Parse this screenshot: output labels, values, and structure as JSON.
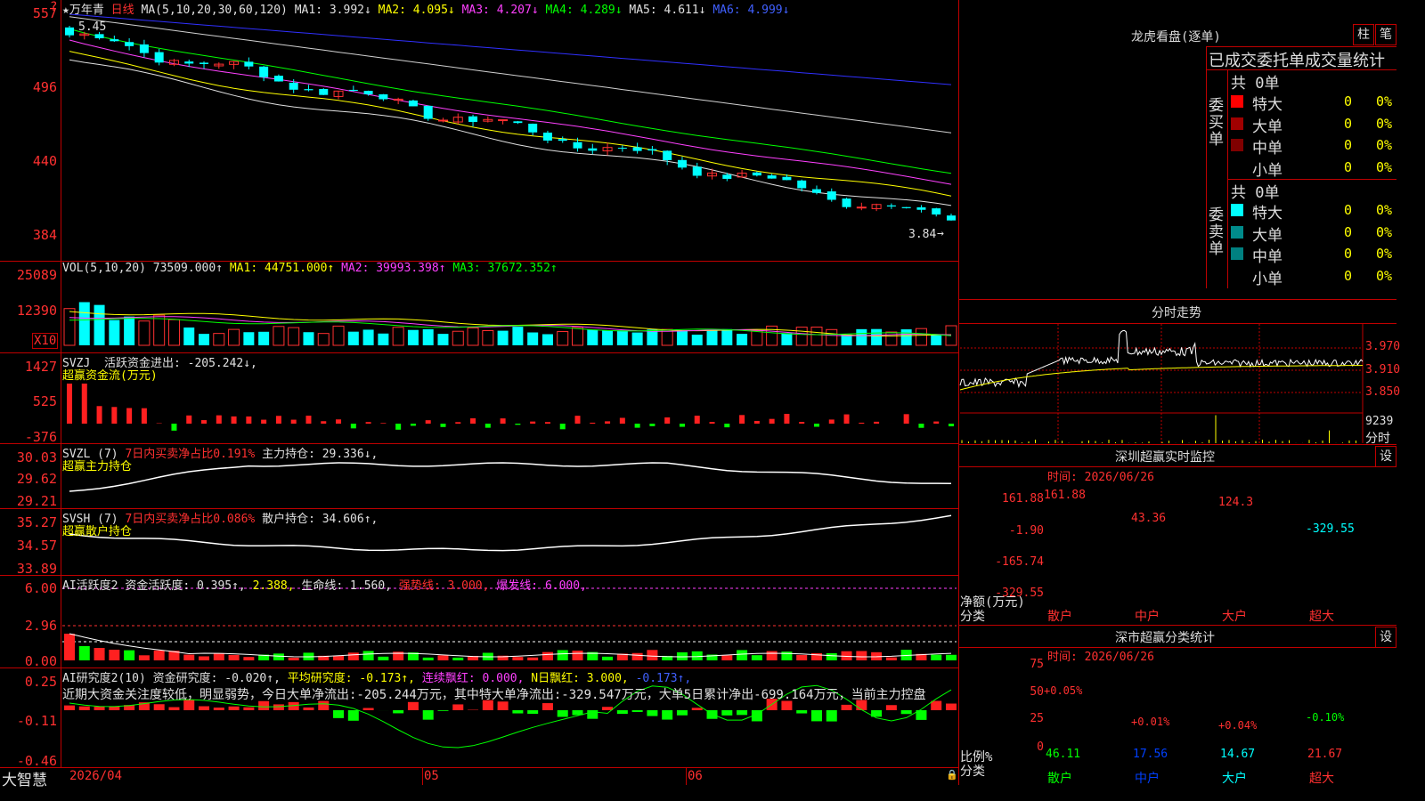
{
  "header": {
    "stock_name": "万年青",
    "period": "日线",
    "ma_label": "MA(5,10,20,30,60,120)",
    "ma1": "MA1: 3.992↓",
    "ma2": "MA2: 4.095↓",
    "ma3": "MA3: 4.207↓",
    "ma4": "MA4: 4.289↓",
    "ma5": "MA5: 4.611↓",
    "ma6": "MA6: 4.999↓"
  },
  "price_axis": [
    "557",
    "496",
    "440",
    "384"
  ],
  "price_high_mark": "5.45",
  "price_low_mark": "3.84",
  "vol": {
    "label": "VOL(5,10,20)",
    "value": "73509.000↑",
    "ma1": "MA1: 44751.000↑",
    "ma2": "MA2: 39993.398↑",
    "ma3": "MA3: 37672.352↑",
    "axis": [
      "25089",
      "12390"
    ],
    "unit": "X10"
  },
  "svzj": {
    "label": "SVZJ",
    "text": "活跃资金进出: -205.242↓,",
    "subtitle": "超赢资金流(万元)",
    "axis": [
      "1427",
      "525",
      "-376"
    ]
  },
  "svzl": {
    "label": "SVZL (7)",
    "ratio": "7日内买卖净占比0.191%",
    "hold": "主力持仓: 29.336↓,",
    "subtitle": "超赢主力持仓",
    "axis": [
      "30.03",
      "29.62",
      "29.21"
    ]
  },
  "svsh": {
    "label": "SVSH (7)",
    "ratio": "7日内买卖净占比0.086%",
    "hold": "散户持仓: 34.606↑,",
    "subtitle": "超赢散户持仓",
    "axis": [
      "35.27",
      "34.57",
      "33.89"
    ]
  },
  "ai_active": {
    "label": "AI活跃度2",
    "value": "资金活跃度: 0.395↑,",
    "v2": "2.388,",
    "life": "生命线: 1.560,",
    "strong": "强势线: 3.000,",
    "burst": "爆发线: 6.000,",
    "axis": [
      "6.00",
      "2.96",
      "0.00"
    ]
  },
  "ai_research": {
    "label": "AI研究度2(10)",
    "value": "资金研究度: -0.020↑,",
    "avg": "平均研究度: -0.173↑,",
    "red": "连续飘红: 0.000,",
    "nred": "N日飘红: 3.000,",
    "last": "-0.173↑,",
    "desc": "近期大资金关注度较低，明显弱势，今日大单净流出:-205.244万元，其中特大单净流出:-329.547万元，大单5日累计净出-699.164万元，当前主力控盘",
    "axis": [
      "0.25",
      "-0.11",
      "-0.46"
    ]
  },
  "footer": {
    "brand": "大智慧",
    "date_start": "2026/04",
    "m05": "05",
    "m06": "06"
  },
  "dragon": {
    "title": "龙虎看盘(逐单)",
    "btn1": "柱",
    "btn2": "笔",
    "subtitle": "已成交委托单成交量统计",
    "buy_label": "委买单",
    "sell_label": "委卖单",
    "buy_total": "共 0单",
    "sell_total": "共 0单",
    "buy_rows": [
      {
        "name": "特大",
        "val": "0",
        "pct": "0%"
      },
      {
        "name": "大单",
        "val": "0",
        "pct": "0%"
      },
      {
        "name": "中单",
        "val": "0",
        "pct": "0%"
      },
      {
        "name": "小单",
        "val": "0",
        "pct": "0%"
      }
    ],
    "sell_rows": [
      {
        "name": "特大",
        "val": "0",
        "pct": "0%"
      },
      {
        "name": "大单",
        "val": "0",
        "pct": "0%"
      },
      {
        "name": "中单",
        "val": "0",
        "pct": "0%"
      },
      {
        "name": "小单",
        "val": "0",
        "pct": "0%"
      }
    ]
  },
  "intraday": {
    "title": "分时走势",
    "axis": [
      "3.970",
      "3.910",
      "3.850"
    ],
    "vol_label": "9239",
    "mode": "分时"
  },
  "sz_monitor": {
    "title": "深圳超赢实时监控",
    "btn": "设",
    "time": "时间: 2026/06/26",
    "axis": [
      "161.88",
      "-1.90",
      "-165.74",
      "-329.55"
    ],
    "ylab1": "净额(万元)",
    "ylab2": "分类",
    "cats": [
      "散户",
      "中户",
      "大户",
      "超大"
    ],
    "values": [
      "161.88",
      "43.36",
      "124.3",
      "-329.55"
    ]
  },
  "sz_class": {
    "title": "深市超赢分类统计",
    "btn": "设",
    "time": "时间: 2026/06/26",
    "axis": [
      "75",
      "50",
      "25",
      "0"
    ],
    "ylab1": "比例%",
    "ylab2": "分类",
    "cats": [
      "散户",
      "中户",
      "大户",
      "超大"
    ],
    "pct_labels": [
      "+0.05%",
      "+0.01%",
      "+0.04%",
      "-0.10%"
    ],
    "values": [
      "46.11",
      "17.56",
      "14.67",
      "21.67"
    ]
  }
}
